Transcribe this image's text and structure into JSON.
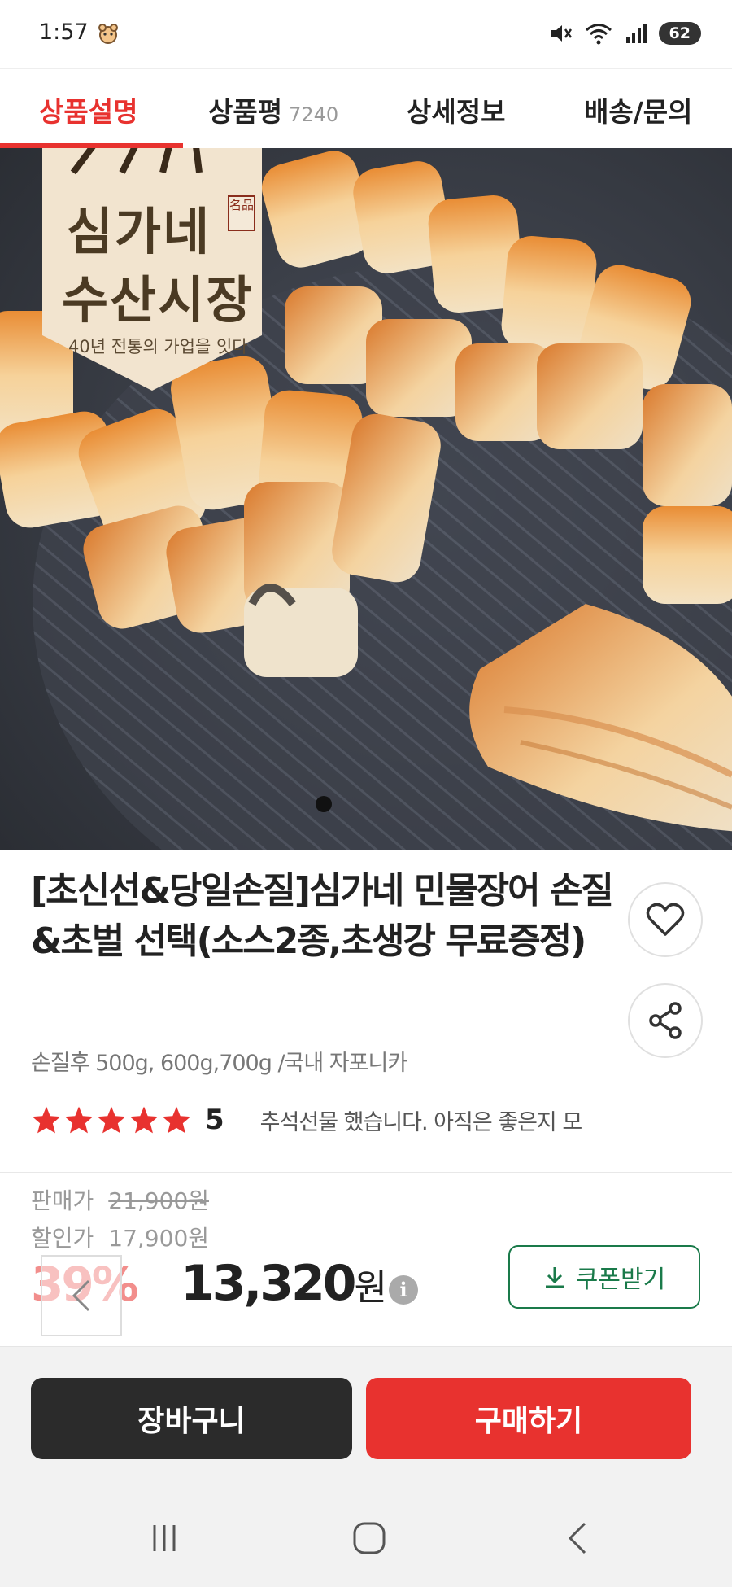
{
  "status_bar": {
    "time": "1:57",
    "battery": "62",
    "icons": [
      "pet-icon",
      "mute-icon",
      "wifi-icon",
      "signal-icon",
      "battery-icon"
    ]
  },
  "tabs": [
    {
      "label": "상품설명",
      "active": true
    },
    {
      "label": "상품평",
      "count": "7240",
      "active": false
    },
    {
      "label": "상세정보",
      "active": false
    },
    {
      "label": "배송/문의",
      "active": false
    }
  ],
  "hero": {
    "banner_line1": "심가네",
    "banner_line2": "수산시장",
    "banner_sub": "40년 전통의 가업을 잇다",
    "seal": "名品",
    "page_index": 1
  },
  "product": {
    "title": "[초신선&당일손질]심가네 민물장어 손질&초벌 선택(소스2종,초생강 무료증정)",
    "option_summary": "손질후 500g, 600g,700g /국내 자포니카",
    "rating": "5",
    "star_count": 5,
    "review_snippet": "추석선물 했습니다. 아직은 좋은지 모"
  },
  "price": {
    "sale_label": "판매가",
    "original_price": "21,900원",
    "discount_label": "할인가",
    "discount_price": "17,900원",
    "discount_rate": "39%",
    "final_price": "13,320",
    "currency": "원",
    "coupon_label": "쿠폰받기"
  },
  "actions": {
    "cart_label": "장바구니",
    "buy_label": "구매하기"
  },
  "colors": {
    "accent": "#e8322f",
    "dark_button": "#2b2b2b",
    "coupon_green": "#1a7a4a"
  }
}
